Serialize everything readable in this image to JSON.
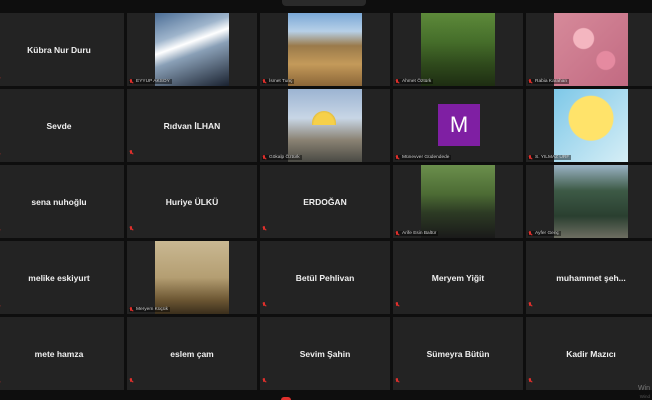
{
  "participants": [
    {
      "display": "center",
      "name": "Kübra Nur Duru"
    },
    {
      "display": "photo",
      "style": "pic-ref",
      "label": "EYYUP AKSOY"
    },
    {
      "display": "photo",
      "style": "pic-land",
      "label": "İsmet Tunç"
    },
    {
      "display": "photo",
      "style": "pic-tree",
      "label": "Ahmet Öztürk"
    },
    {
      "display": "photo",
      "style": "pic-flower",
      "label": "Rabia Karahan"
    },
    {
      "display": "center",
      "name": "Sevde"
    },
    {
      "display": "center",
      "name": "Rıdvan İLHAN"
    },
    {
      "display": "photo",
      "style": "pic-mosque",
      "label": "Gökalp Öztürk"
    },
    {
      "display": "avatar",
      "initial": "M",
      "label": "Münevver Güdendede"
    },
    {
      "display": "photo",
      "style": "pic-anime",
      "label": "S. YILMAZ URF"
    },
    {
      "display": "center",
      "name": "sena nuhoğlu"
    },
    {
      "display": "center",
      "name": "Huriye ÜLKÜ"
    },
    {
      "display": "center",
      "name": "ERDOĞAN"
    },
    {
      "display": "photo",
      "style": "pic-people",
      "label": "Arife Esin Baltür"
    },
    {
      "display": "photo",
      "style": "pic-forest",
      "label": "Ayfer Genç"
    },
    {
      "display": "center",
      "name": "melike eskiyurt"
    },
    {
      "display": "photo",
      "style": "pic-paint",
      "label": "Meryem Küçük"
    },
    {
      "display": "center",
      "name": "Betül Pehlivan"
    },
    {
      "display": "center",
      "name": "Meryem Yiğit"
    },
    {
      "display": "center",
      "name": "muhammet şeh..."
    },
    {
      "display": "center",
      "name": "mete hamza"
    },
    {
      "display": "center",
      "name": "eslem çam"
    },
    {
      "display": "center",
      "name": "Sevim Şahin"
    },
    {
      "display": "center",
      "name": "Sümeyra Bütün"
    },
    {
      "display": "center",
      "name": "Kadir Mazıcı"
    }
  ],
  "watermark": {
    "line1": "Win",
    "line2": "Wind"
  },
  "colors": {
    "background": "#0e0e0e",
    "tile": "#232323",
    "mute_red": "#e0302c",
    "avatar_purple": "#7f1fa3"
  },
  "icons": {
    "mute": "mic-muted-icon"
  }
}
